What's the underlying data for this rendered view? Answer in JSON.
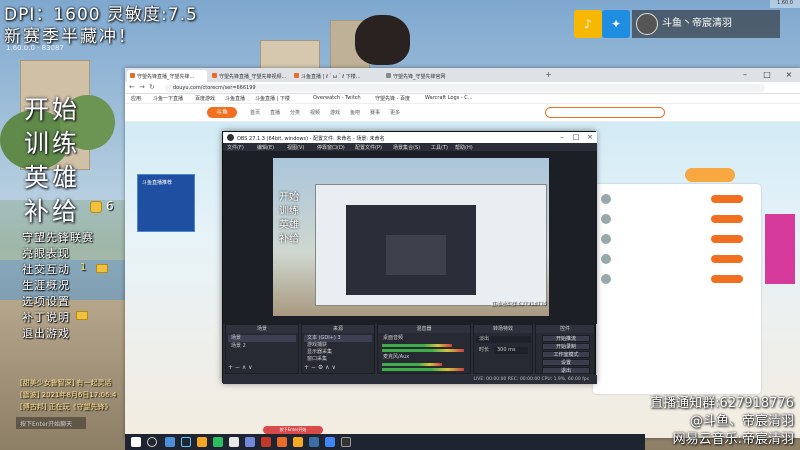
{
  "overlay": {
    "dpi": "DPI：1600 灵敏度:7.5",
    "slogan": "新赛季半藏冲！",
    "game_version": "1.60.0.0 · 83087"
  },
  "game_menu": {
    "big_items": [
      "开始",
      "训练",
      "英雄",
      "补给"
    ],
    "coin_count": "6",
    "small_items": [
      "守望先锋联赛",
      "亮眼表现",
      "社交互动",
      "生涯概况",
      "选项设置",
      "补丁说明",
      "退出游戏"
    ],
    "social_count": "1"
  },
  "chat": {
    "lines": [
      "[甜美少女鲁智深] 有一起灵活",
      "[震波] 2021年8月6日17:06:4",
      "[博古邦] 正在玩《守望先锋》"
    ],
    "input_placeholder": "按下Enter开始聊天"
  },
  "notification": {
    "name": "斗鱼丶帝宸清羽",
    "tile1_icon": "♪",
    "tile2_icon": "✦",
    "corner": "1.60.0"
  },
  "browser": {
    "tabs": [
      "守望先锋直播_守望先锋...",
      "守望先锋直播_守望先锋视频...",
      "斗鱼直播 | ℓ＾ω＾ℓ 下楼...",
      "守望先锋_守望先锋官网"
    ],
    "url": "douyu.com/ctorecm/ser=666199",
    "bookmarks": [
      "应用",
      "斗鱼一下直播",
      "百度游戏",
      "斗鱼直播",
      "斗鱼直播 | 下楼",
      "Overwatch - Twitch",
      "守望先锋 - 百度",
      "Warcraft Logs - C..."
    ],
    "site_logo": "斗鱼",
    "site_nav": [
      "首页",
      "直播",
      "分类",
      "视频",
      "游戏",
      "鱼吧",
      "赛事",
      "更多"
    ],
    "left_card_title": "斗鱼直播推荐"
  },
  "obs": {
    "title": "OBS 27.1.3 (64bit, windows) - 配置文件: 未命名 - 场景: 未命名",
    "menu": [
      "文件(F)",
      "编辑(E)",
      "视图(V)",
      "停靠窗口(D)",
      "配置文件(P)",
      "场景集合(S)",
      "工具(T)",
      "帮助(H)"
    ],
    "preview_text": [
      "开始",
      "训练",
      "英雄",
      "补给"
    ],
    "preview_caption": "直播通知群:627918776",
    "docks": {
      "scenes": {
        "title": "场景",
        "items": [
          "场景",
          "场景 2"
        ]
      },
      "sources": {
        "title": "来源",
        "items": [
          "文本 (GDI+) 3",
          "游戏捕获",
          "显示器采集",
          "窗口采集"
        ]
      },
      "mixer": {
        "title": "混音器",
        "channels": [
          "桌面音频",
          "麦克风/Aux"
        ]
      },
      "transitions": {
        "title": "转场特效",
        "type": "淡出",
        "duration_label": "时长",
        "duration": "300 ms"
      },
      "controls": {
        "title": "控件",
        "buttons": [
          "开始推流",
          "开始录制",
          "工作室模式",
          "设置",
          "退出"
        ]
      }
    },
    "status": "LIVE: 00:00:00   REC: 00:00:00   CPU: 1.9%, 60.00 fps"
  },
  "taskbar": {
    "popup": "按下Enter开始"
  },
  "caption": {
    "line1": "直播通知群:627918776",
    "line2": "@斗鱼、帝宸清羽",
    "line3": "网易云音乐:帝宸清羽"
  },
  "colors": {
    "douyu_orange": "#f36f20",
    "obs_bg": "#2b2e38",
    "notif_yellow": "#f6b800",
    "notif_blue": "#1f8de0"
  }
}
